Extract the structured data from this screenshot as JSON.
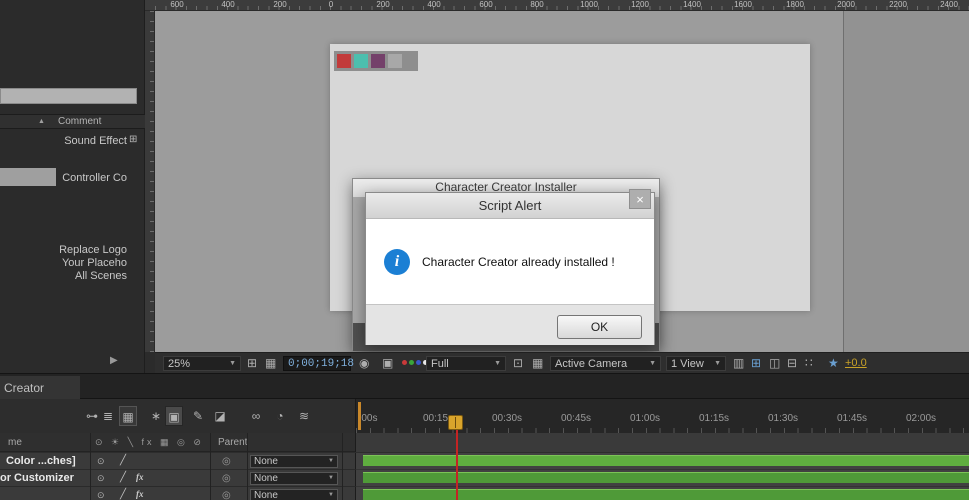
{
  "top_ruler": {
    "labels": [
      "600",
      "400",
      "200",
      "0",
      "200",
      "400",
      "600",
      "800",
      "1000",
      "1200",
      "1400",
      "1600",
      "1800",
      "2000",
      "2200",
      "2400"
    ]
  },
  "left_panel": {
    "header_label": "Comment",
    "collapse_icon": "▲",
    "item_icon": "⊞",
    "items": [
      {
        "label": "Sound Effect"
      },
      {
        "label": "Controller Co"
      },
      {
        "label": "Replace Logo"
      },
      {
        "label": "Your Placeho"
      },
      {
        "label": "All Scenes"
      }
    ],
    "expand_arrow": "▶"
  },
  "swatches": [
    "#c23a3a",
    "#4cbfae",
    "#74406a",
    "#a8a8a8"
  ],
  "installer_dialog": {
    "title": "Character Creator Installer"
  },
  "alert_dialog": {
    "title": "Script Alert",
    "close_glyph": "×",
    "info_glyph": "i",
    "message": "Character Creator already installed !",
    "ok_label": "OK"
  },
  "viewport_toolbar": {
    "zoom": "25%",
    "grid_icon": "⊞",
    "transparency_icon": "▦",
    "timecode": "0;00;19;18",
    "camera_icon": "◉",
    "snapshot_icon": "▣",
    "resolution": "Full",
    "roi_icon": "⊡",
    "checker_icon": "▦",
    "camera_view": "Active Camera",
    "view_layout": "1 View",
    "grid_icons": [
      "▥",
      "⊞",
      "◫",
      "⊟",
      "∷"
    ],
    "star_icon": "★",
    "exposure": "+0.0",
    "dropdown_arrow": "▼"
  },
  "tabs": {
    "active": "Creator"
  },
  "timeline": {
    "toolbar_icons": [
      "⊶",
      "≣",
      "▦",
      "∗",
      "▣",
      "✎",
      "◪",
      "∞",
      "◔",
      "≋"
    ],
    "ruler_labels": [
      ":00s",
      "00:15s",
      "00:30s",
      "00:45s",
      "01:00s",
      "01:15s",
      "01:30s",
      "01:45s",
      "02:00s"
    ],
    "header": {
      "name_col": "me",
      "switches": "⊙ ☀ ╲ fx ▦ ◎ ⊘",
      "parent_col": "Parent"
    },
    "rows": [
      {
        "label": "Color ...ches]",
        "eye": "⊙",
        "quality": "╱",
        "fx": "",
        "pick_whip": "◎",
        "parent_value": "None"
      },
      {
        "label": "or Customizer",
        "eye": "⊙",
        "quality": "╱",
        "fx": "fx",
        "pick_whip": "◎",
        "parent_value": "None"
      },
      {
        "label": "",
        "eye": "⊙",
        "quality": "╱",
        "fx": "fx",
        "pick_whip": "◎",
        "parent_value": "None"
      }
    ]
  },
  "colors": {
    "info_blue": "#1b7fd4",
    "timecode_blue": "#7fb0dd",
    "exposure_gold": "#c9a227",
    "layer_bar_bright": "#5fae3f",
    "layer_bar": "#4f9a38",
    "cti_head": "#d9a42b",
    "cti_line": "#c42424",
    "work_area_orange": "#c9882a",
    "rgb_dots": [
      "#c83a3a",
      "#3aa53a",
      "#3a55c8",
      "#e8e8e8"
    ]
  }
}
